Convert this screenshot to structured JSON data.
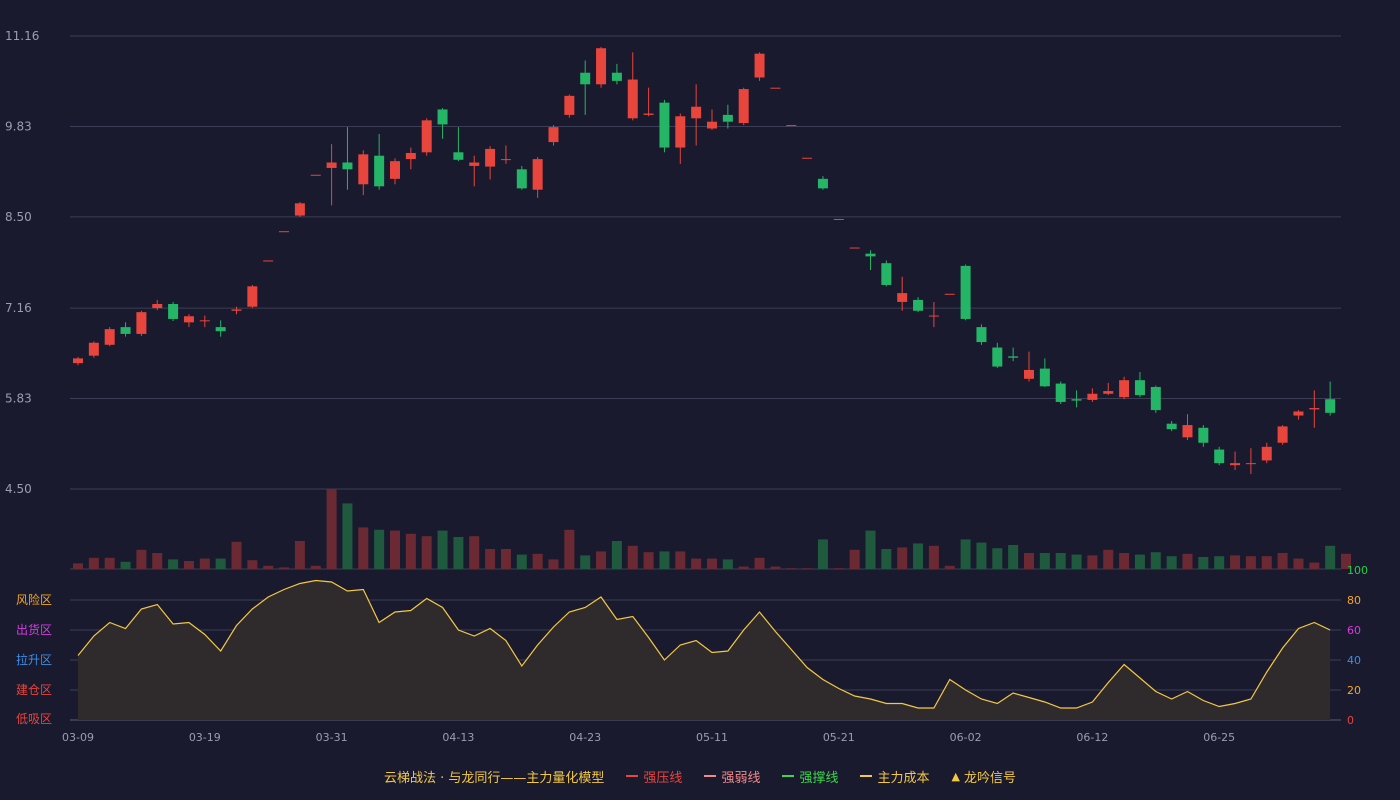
{
  "colors": {
    "background": "#191a2e",
    "grid": "#3c3e56",
    "axis_text": "#9a9db0",
    "up": "#e8453c",
    "down": "#25b567",
    "vol_up": "#6b2a33",
    "vol_down": "#1f5a3e",
    "oscillator": "#f5c842",
    "oscillator_fill": "#2f2b2c"
  },
  "chart_data": {
    "type": "candlestick",
    "x_labels": [
      "03-09",
      "03-19",
      "03-31",
      "04-13",
      "04-23",
      "05-11",
      "05-21",
      "06-02",
      "06-12",
      "06-25"
    ],
    "x_label_index": [
      0,
      8,
      16,
      24,
      32,
      40,
      48,
      56,
      64,
      72
    ],
    "price_axis": {
      "ticks": [
        "11.16",
        "9.83",
        "8.50",
        "7.16",
        "5.83",
        "4.50"
      ],
      "min": 4.5,
      "max": 11.16
    },
    "candles": [
      [
        6.35,
        6.42,
        6.32,
        6.44
      ],
      [
        6.46,
        6.65,
        6.43,
        6.67
      ],
      [
        6.62,
        6.85,
        6.6,
        6.88
      ],
      [
        6.88,
        6.78,
        6.74,
        6.95
      ],
      [
        6.78,
        7.1,
        6.75,
        7.12
      ],
      [
        7.16,
        7.22,
        7.13,
        7.28
      ],
      [
        7.22,
        7.0,
        6.97,
        7.25
      ],
      [
        6.95,
        7.04,
        6.88,
        7.07
      ],
      [
        6.97,
        6.98,
        6.88,
        7.05
      ],
      [
        6.88,
        6.82,
        6.74,
        6.98
      ],
      [
        7.12,
        7.14,
        7.07,
        7.18
      ],
      [
        7.18,
        7.48,
        7.16,
        7.5
      ],
      [
        7.86,
        7.86,
        7.86,
        7.86
      ],
      [
        8.29,
        8.29,
        8.29,
        8.29
      ],
      [
        8.52,
        8.7,
        8.5,
        8.72
      ],
      [
        9.12,
        9.12,
        9.12,
        9.12
      ],
      [
        9.22,
        9.3,
        8.67,
        9.57
      ],
      [
        9.3,
        9.2,
        8.9,
        9.82
      ],
      [
        8.98,
        9.42,
        8.82,
        9.48
      ],
      [
        9.4,
        8.95,
        8.9,
        9.72
      ],
      [
        9.06,
        9.32,
        8.98,
        9.36
      ],
      [
        9.35,
        9.44,
        9.2,
        9.52
      ],
      [
        9.45,
        9.92,
        9.4,
        9.95
      ],
      [
        10.08,
        9.86,
        9.65,
        10.1
      ],
      [
        9.45,
        9.34,
        9.32,
        9.82
      ],
      [
        9.25,
        9.3,
        8.95,
        9.4
      ],
      [
        9.24,
        9.5,
        9.05,
        9.54
      ],
      [
        9.35,
        9.35,
        9.28,
        9.55
      ],
      [
        9.2,
        8.92,
        8.9,
        9.25
      ],
      [
        8.9,
        9.35,
        8.78,
        9.38
      ],
      [
        9.6,
        9.82,
        9.55,
        9.85
      ],
      [
        10.0,
        10.28,
        9.96,
        10.3
      ],
      [
        10.62,
        10.45,
        10.0,
        10.8
      ],
      [
        10.45,
        10.98,
        10.4,
        11.0
      ],
      [
        10.62,
        10.5,
        10.45,
        10.75
      ],
      [
        9.95,
        10.52,
        9.92,
        10.92
      ],
      [
        10.0,
        10.02,
        9.98,
        10.4
      ],
      [
        10.18,
        9.52,
        9.45,
        10.22
      ],
      [
        9.52,
        9.98,
        9.28,
        10.02
      ],
      [
        9.95,
        10.12,
        9.55,
        10.45
      ],
      [
        9.8,
        9.9,
        9.78,
        10.08
      ],
      [
        10.0,
        9.9,
        9.8,
        10.15
      ],
      [
        9.88,
        10.38,
        9.85,
        10.4
      ],
      [
        10.55,
        10.9,
        10.5,
        10.92
      ],
      [
        10.4,
        10.4,
        10.4,
        10.4
      ],
      [
        9.85,
        9.85,
        9.85,
        9.85
      ],
      [
        9.37,
        9.37,
        9.37,
        9.37
      ],
      [
        9.06,
        8.92,
        8.9,
        9.1
      ],
      [
        8.47,
        8.47,
        8.47,
        8.47
      ],
      [
        8.05,
        8.05,
        8.05,
        8.05
      ],
      [
        7.96,
        7.92,
        7.72,
        8.01
      ],
      [
        7.82,
        7.5,
        7.48,
        7.86
      ],
      [
        7.25,
        7.38,
        7.12,
        7.62
      ],
      [
        7.28,
        7.12,
        7.1,
        7.32
      ],
      [
        7.05,
        7.05,
        6.88,
        7.25
      ],
      [
        7.37,
        7.37,
        7.37,
        7.37
      ],
      [
        7.78,
        7.0,
        6.98,
        7.8
      ],
      [
        6.88,
        6.66,
        6.62,
        6.92
      ],
      [
        6.58,
        6.3,
        6.28,
        6.65
      ],
      [
        6.45,
        6.43,
        6.38,
        6.58
      ],
      [
        6.12,
        6.25,
        6.08,
        6.52
      ],
      [
        6.27,
        6.01,
        6.0,
        6.42
      ],
      [
        6.05,
        5.78,
        5.75,
        6.08
      ],
      [
        5.82,
        5.8,
        5.7,
        5.95
      ],
      [
        5.81,
        5.9,
        5.78,
        5.98
      ],
      [
        5.9,
        5.94,
        5.88,
        6.06
      ],
      [
        5.85,
        6.1,
        5.82,
        6.15
      ],
      [
        6.1,
        5.88,
        5.85,
        6.22
      ],
      [
        6.0,
        5.66,
        5.62,
        6.02
      ],
      [
        5.46,
        5.38,
        5.35,
        5.5
      ],
      [
        5.26,
        5.44,
        5.22,
        5.6
      ],
      [
        5.4,
        5.18,
        5.12,
        5.44
      ],
      [
        5.08,
        4.88,
        4.85,
        5.12
      ],
      [
        4.85,
        4.88,
        4.78,
        5.05
      ],
      [
        4.88,
        4.88,
        4.72,
        5.1
      ],
      [
        4.92,
        5.12,
        4.88,
        5.18
      ],
      [
        5.18,
        5.42,
        5.15,
        5.44
      ],
      [
        5.58,
        5.64,
        5.52,
        5.66
      ],
      [
        5.67,
        5.69,
        5.4,
        5.95
      ],
      [
        5.82,
        5.62,
        5.58,
        6.08
      ]
    ],
    "volume": [
      7,
      14,
      14,
      9,
      24,
      20,
      12,
      10,
      13,
      13,
      34,
      11,
      4,
      2,
      35,
      4,
      100,
      82,
      52,
      49,
      48,
      44,
      41,
      48,
      40,
      41,
      25,
      25,
      18,
      19,
      12,
      49,
      17,
      22,
      35,
      29,
      21,
      22,
      22,
      13,
      13,
      12,
      3,
      14,
      3,
      1,
      1,
      37,
      1,
      24,
      48,
      25,
      27,
      32,
      29,
      4,
      37,
      33,
      26,
      30,
      20,
      20,
      20,
      18,
      17,
      24,
      20,
      18,
      21,
      16,
      19,
      15,
      16,
      17,
      16,
      16,
      20,
      13,
      8,
      29,
      19
    ],
    "oscillator": {
      "axis_ticks": [
        "100",
        "80",
        "60",
        "40",
        "20",
        "0"
      ],
      "axis_tick_colors": [
        "#25d13c",
        "#f5a623",
        "#d63ce0",
        "#3a8ee6",
        "#f5a623",
        "#e8453c"
      ],
      "min": 0,
      "max": 100,
      "zones": [
        {
          "label": "风险区",
          "color": "#f5a623"
        },
        {
          "label": "出货区",
          "color": "#d63ce0"
        },
        {
          "label": "拉升区",
          "color": "#3a8ee6"
        },
        {
          "label": "建仓区",
          "color": "#e8453c"
        },
        {
          "label": "低吸区",
          "color": "#e8453c"
        }
      ],
      "values": [
        43,
        56,
        65,
        61,
        74,
        77,
        64,
        65,
        57,
        46,
        63,
        74,
        82,
        87,
        91,
        93,
        92,
        86,
        87,
        65,
        72,
        73,
        81,
        75,
        60,
        56,
        61,
        53,
        36,
        50,
        62,
        72,
        75,
        82,
        67,
        69,
        55,
        40,
        50,
        53,
        45,
        46,
        60,
        72,
        59,
        47,
        35,
        27,
        21,
        16,
        14,
        11,
        11,
        8,
        8,
        27,
        20,
        14,
        11,
        18,
        15,
        12,
        8,
        8,
        12,
        25,
        37,
        28,
        19,
        14,
        19,
        13,
        9,
        11,
        14,
        32,
        48,
        61,
        65,
        60
      ]
    }
  },
  "legend": {
    "title": "云梯战法 · 与龙同行——主力量化模型",
    "items": [
      {
        "label": "强压线",
        "color": "#e8453c",
        "style": "solid"
      },
      {
        "label": "强弱线",
        "color": "#f08a8a",
        "style": "dashed"
      },
      {
        "label": "强撑线",
        "color": "#3cd64a",
        "style": "solid"
      },
      {
        "label": "主力成本",
        "color": "#f5c842",
        "style": "dashed"
      },
      {
        "label": "龙吟信号",
        "color": "#f5c842",
        "style": "triangle"
      }
    ]
  }
}
